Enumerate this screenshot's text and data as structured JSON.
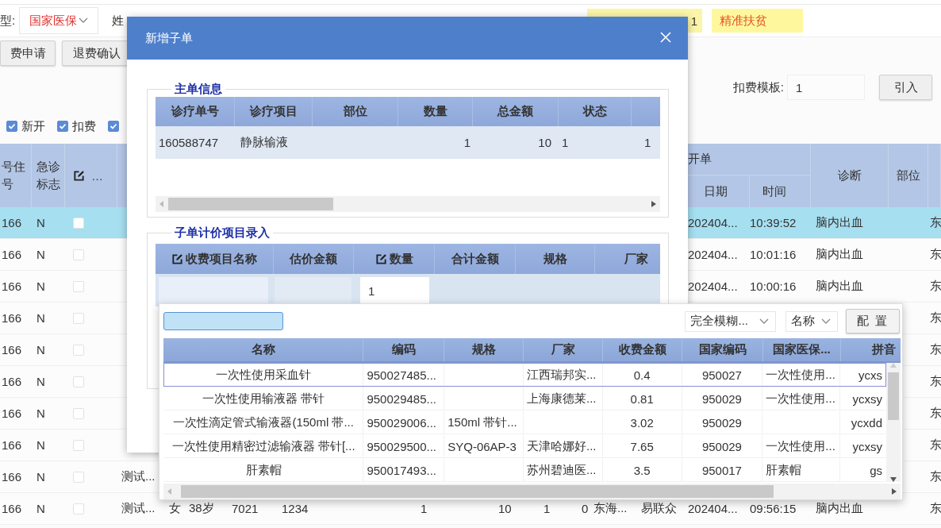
{
  "top_bar": {
    "type_label": "型:",
    "insurance_select": "国家医保",
    "name_label": "姓",
    "field_value": "1",
    "tag": "精准扶贫"
  },
  "toolbar": {
    "buttons": [
      "费申请",
      "退费确认"
    ],
    "template_label": "扣费模板:",
    "template_value": "1",
    "import_button": "引入"
  },
  "filters": [
    {
      "label": "新开",
      "checked": true
    },
    {
      "label": "扣费",
      "checked": true
    },
    {
      "checked": true
    }
  ],
  "grid": {
    "header": {
      "column_1": "号住号",
      "emergency_flag": "急诊标志",
      "checkbox_column": {
        "label": "…",
        "editable": true
      },
      "group": "开单",
      "date": "日期",
      "time": "时间",
      "diagnosis": "诊断",
      "site": "部位"
    },
    "rows": [
      {
        "selected": true,
        "column_1": "166",
        "emergency_flag": "N",
        "checked": false,
        "date": "202404...",
        "time": "10:39:52",
        "diagnosis": "脑内出血",
        "column_19": "东"
      },
      {
        "selected": false,
        "column_1": "166",
        "emergency_flag": "N",
        "checked": false,
        "date": "202404...",
        "time": "10:01:16",
        "diagnosis": "脑内出血",
        "column_19": "东"
      },
      {
        "selected": false,
        "column_1": "166",
        "emergency_flag": "N",
        "checked": false,
        "date": "202404...",
        "time": "10:00:16",
        "diagnosis": "脑内出血",
        "column_19": "东"
      },
      {
        "selected": false,
        "column_1": "166",
        "emergency_flag": "N",
        "checked": false,
        "column_19": "东"
      },
      {
        "selected": false,
        "column_1": "166",
        "emergency_flag": "N",
        "checked": false,
        "column_19": "东"
      },
      {
        "selected": false,
        "column_1": "166",
        "emergency_flag": "N",
        "checked": false,
        "column_19": "东"
      },
      {
        "selected": false,
        "column_1": "166",
        "emergency_flag": "N",
        "checked": false,
        "column_19": "东"
      },
      {
        "selected": false,
        "column_1": "166",
        "emergency_flag": "N",
        "checked": false,
        "column_19": "东"
      },
      {
        "selected": false,
        "column_1": "166",
        "emergency_flag": "N",
        "checked": false,
        "column_4": "测试...",
        "column_19": "东"
      },
      {
        "selected": false,
        "column_1": "166",
        "emergency_flag": "N",
        "checked": false,
        "column_4": "测试...",
        "column_5": "女",
        "column_6": "38岁",
        "column_7": "7021",
        "column_8": "1234",
        "column_9": "1",
        "column_10": "10",
        "column_11": "1",
        "column_12": "0",
        "column_13": "东海...",
        "column_14": "易联众",
        "date": "202404...",
        "time": "09:56:15",
        "diagnosis": "脑内出血",
        "column_19": "东"
      }
    ]
  },
  "dialog": {
    "title": "新增子单",
    "main_section": {
      "legend": "主单信息",
      "columns": [
        "诊疗单号",
        "诊疗项目",
        "部位",
        "数量",
        "总金额",
        "状态"
      ],
      "row": {
        "order_no": "160588747",
        "item": "静脉输液",
        "quantity": "1",
        "total": "10",
        "status": "1",
        "column_7": "1"
      }
    },
    "sub_section": {
      "legend": "子单计价项目录入",
      "columns": [
        {
          "label": "收费项目名称",
          "editable": true
        },
        {
          "label": "估价金额",
          "editable": false
        },
        {
          "label": "数量",
          "editable": true
        },
        {
          "label": "合计金额",
          "editable": false
        },
        {
          "label": "规格",
          "editable": false
        },
        {
          "label": "厂家",
          "editable": false
        }
      ],
      "row": {
        "quantity": "1"
      }
    }
  },
  "picker": {
    "match_select": "完全模糊...",
    "field_select": "名称",
    "config_button": "配 置",
    "columns": [
      "名称",
      "编码",
      "规格",
      "厂家",
      "收费金额",
      "国家编码",
      "国家医保...",
      "拼音"
    ],
    "rows": [
      {
        "selected": true,
        "name": "一次性使用采血针",
        "code": "950027485...",
        "maker": "江西瑞邦实...",
        "fee": "0.4",
        "national_code": "950027",
        "insurance_name": "一次性使用...",
        "pinyin": "ycxs"
      },
      {
        "selected": false,
        "name": "一次性使用输液器 带针",
        "code": "950029485...",
        "maker": "上海康德莱...",
        "fee": "0.81",
        "national_code": "950029",
        "insurance_name": "一次性使用...",
        "pinyin": "ycxsy"
      },
      {
        "selected": false,
        "name": "一次性滴定管式输液器(150ml 带...",
        "code": "950029006...",
        "spec": "150ml 带针...",
        "fee": "3.02",
        "national_code": "950029",
        "pinyin": "ycxdd"
      },
      {
        "selected": false,
        "name": "一次性使用精密过滤输液器 带针[...",
        "code": "950029500...",
        "spec": "SYQ-06AP-3",
        "maker": "天津哈娜好...",
        "fee": "7.65",
        "national_code": "950029",
        "insurance_name": "一次性使用...",
        "pinyin": "ycxsy"
      },
      {
        "selected": false,
        "name": "肝素帽",
        "code": "950017493...",
        "maker": "苏州碧迪医...",
        "fee": "3.5",
        "national_code": "950017",
        "insurance_name": "肝素帽",
        "pinyin": "gs"
      }
    ]
  }
}
